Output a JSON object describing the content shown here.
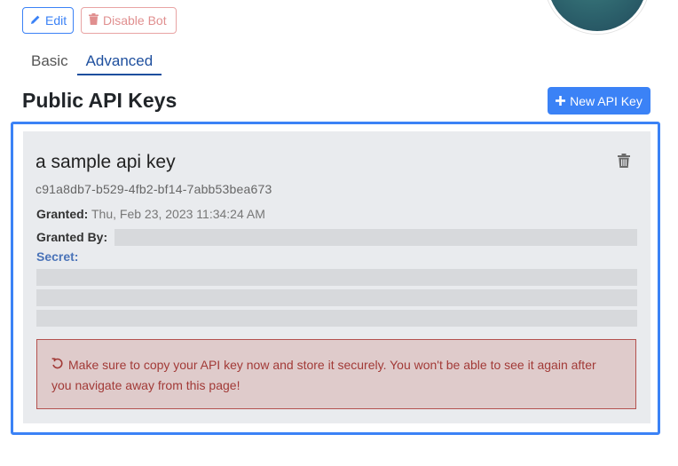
{
  "toolbar": {
    "edit_label": "Edit",
    "disable_label": "Disable Bot"
  },
  "tabs": [
    {
      "label": "Basic",
      "active": false
    },
    {
      "label": "Advanced",
      "active": true
    }
  ],
  "section": {
    "title": "Public API Keys",
    "new_button_label": "New API Key"
  },
  "api_key": {
    "name": "a sample api key",
    "id": "c91a8db7-b529-4fb2-bf14-7abb53bea673",
    "granted_label": "Granted:",
    "granted_value": "Thu, Feb 23, 2023 11:34:24 AM",
    "granted_by_label": "Granted By:",
    "secret_label": "Secret:"
  },
  "alert": {
    "message": "Make sure to copy your API key now and store it securely. You won't be able to see it again after you navigate away from this page!"
  },
  "colors": {
    "accent": "#3b82f6",
    "danger": "#a23a37",
    "card_bg": "#e9ebee"
  },
  "icons": {
    "edit": "pencil-icon",
    "disable": "trash-icon",
    "new": "plus-icon",
    "delete": "trash-icon",
    "alert": "undo-icon"
  }
}
